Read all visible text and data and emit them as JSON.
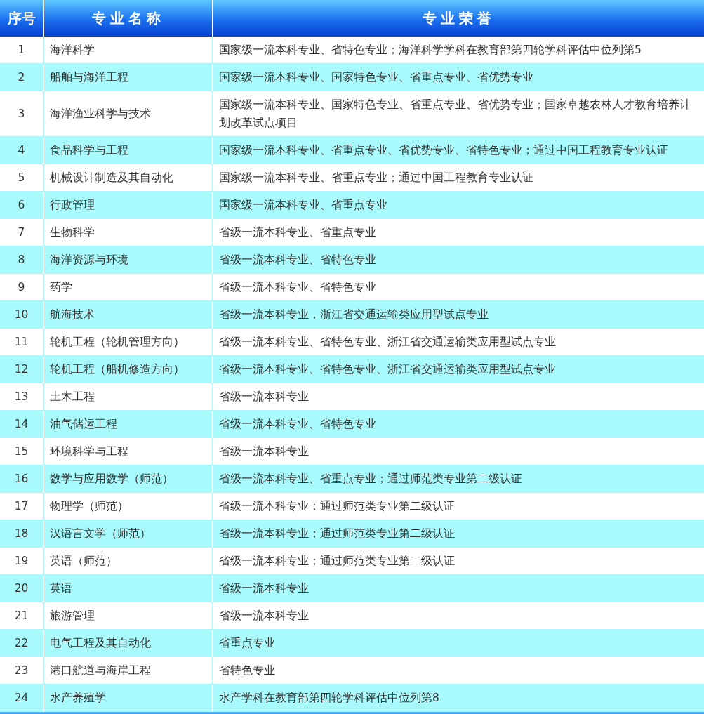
{
  "table": {
    "columns": [
      "序号",
      "专业名称",
      "专业荣誉"
    ],
    "rows": [
      [
        "1",
        "海洋科学",
        "国家级一流本科专业、省特色专业；海洋科学学科在教育部第四轮学科评估中位列第5"
      ],
      [
        "2",
        "船舶与海洋工程",
        "国家级一流本科专业、国家特色专业、省重点专业、省优势专业"
      ],
      [
        "3",
        "海洋渔业科学与技术",
        "国家级一流本科专业、国家特色专业、省重点专业、省优势专业；国家卓越农林人才教育培养计划改革试点项目"
      ],
      [
        "4",
        "食品科学与工程",
        "国家级一流本科专业、省重点专业、省优势专业、省特色专业；通过中国工程教育专业认证"
      ],
      [
        "5",
        "机械设计制造及其自动化",
        "国家级一流本科专业、省重点专业；通过中国工程教育专业认证"
      ],
      [
        "6",
        "行政管理",
        "国家级一流本科专业、省重点专业"
      ],
      [
        "7",
        "生物科学",
        "省级一流本科专业、省重点专业"
      ],
      [
        "8",
        "海洋资源与环境",
        "省级一流本科专业、省特色专业"
      ],
      [
        "9",
        "药学",
        "省级一流本科专业、省特色专业"
      ],
      [
        "10",
        "航海技术",
        "省级一流本科专业，浙江省交通运输类应用型试点专业"
      ],
      [
        "11",
        "轮机工程（轮机管理方向）",
        "省级一流本科专业、省特色专业、浙江省交通运输类应用型试点专业"
      ],
      [
        "12",
        "轮机工程（船机修造方向）",
        "省级一流本科专业、省特色专业、浙江省交通运输类应用型试点专业"
      ],
      [
        "13",
        "土木工程",
        "省级一流本科专业"
      ],
      [
        "14",
        "油气储运工程",
        "省级一流本科专业、省特色专业"
      ],
      [
        "15",
        "环境科学与工程",
        "省级一流本科专业"
      ],
      [
        "16",
        "数学与应用数学（师范）",
        "省级一流本科专业、省重点专业；通过师范类专业第二级认证"
      ],
      [
        "17",
        "物理学（师范）",
        "省级一流本科专业；通过师范类专业第二级认证"
      ],
      [
        "18",
        "汉语言文学（师范）",
        "省级一流本科专业；通过师范类专业第二级认证"
      ],
      [
        "19",
        "英语（师范）",
        "省级一流本科专业；通过师范类专业第二级认证"
      ],
      [
        "20",
        "英语",
        "省级一流本科专业"
      ],
      [
        "21",
        "旅游管理",
        "省级一流本科专业"
      ],
      [
        "22",
        "电气工程及其自动化",
        "省重点专业"
      ],
      [
        "23",
        "港口航道与海岸工程",
        "省特色专业"
      ],
      [
        "24",
        "水产养殖学",
        "水产学科在教育部第四轮学科评估中位列第8"
      ]
    ]
  }
}
